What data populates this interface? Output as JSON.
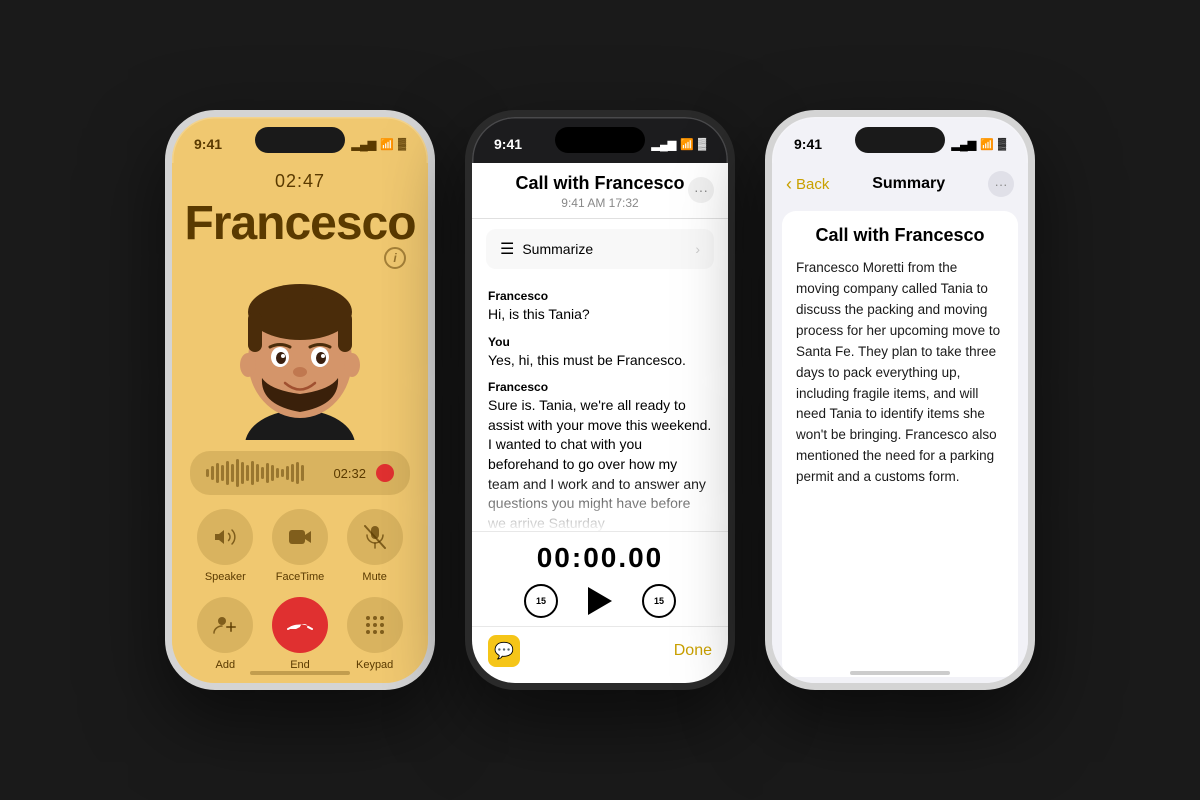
{
  "page": {
    "background": "#1a1a1a"
  },
  "phone1": {
    "status": {
      "time": "9:41",
      "signal": "▂▄▆",
      "wifi": "WiFi",
      "battery": "🔋"
    },
    "call_duration_top": "02:47",
    "caller_name": "Francesco",
    "recording_time": "02:32",
    "controls": {
      "row1": [
        {
          "icon": "🔊",
          "label": "Speaker"
        },
        {
          "icon": "📹",
          "label": "FaceTime"
        },
        {
          "icon": "🎤",
          "label": "Mute"
        }
      ],
      "row2": [
        {
          "icon": "👤",
          "label": "Add"
        },
        {
          "icon": "📞",
          "label": "End",
          "type": "end"
        },
        {
          "icon": "⌨️",
          "label": "Keypad"
        }
      ]
    }
  },
  "phone2": {
    "status": {
      "time": "9:41",
      "signal": "▂▄▆",
      "wifi": "WiFi",
      "battery": "🔋"
    },
    "title": "Call with Francesco",
    "subtitle": "9:41 AM  17:32",
    "more_icon": "···",
    "summarize_label": "Summarize",
    "transcript": [
      {
        "speaker": "Francesco",
        "text": "Hi, is this Tania?"
      },
      {
        "speaker": "You",
        "text": "Yes, hi, this must be Francesco."
      },
      {
        "speaker": "Francesco",
        "text": "Sure is. Tania, we're all ready to assist with your move this weekend. I wanted to chat with you beforehand to go over how my team and I work and to answer any questions you might have before we arrive Saturday"
      }
    ],
    "playback_time": "00:00.00",
    "done_label": "Done"
  },
  "phone3": {
    "status": {
      "time": "9:41",
      "signal": "▂▄▆",
      "wifi": "WiFi",
      "battery": "🔋"
    },
    "back_label": "Back",
    "title": "Summary",
    "more_icon": "···",
    "summary_title": "Call with Francesco",
    "summary_text": "Francesco Moretti from the moving company called Tania to discuss the packing and moving process for her upcoming move to Santa Fe. They plan to take three days to pack everything up, including fragile items, and will need Tania to identify items she won't be bringing. Francesco also mentioned the need for a parking permit and a customs form."
  }
}
